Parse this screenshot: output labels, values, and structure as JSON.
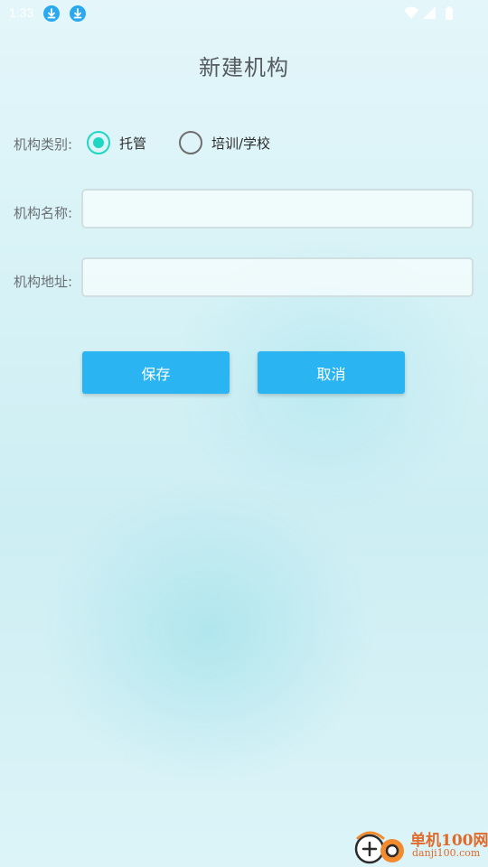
{
  "status_bar": {
    "time": "1:33",
    "icons": [
      "download-icon",
      "download-icon",
      "wifi-icon",
      "signal-icon",
      "battery-icon"
    ]
  },
  "page": {
    "title": "新建机构"
  },
  "form": {
    "category": {
      "label": "机构类别:",
      "options": [
        {
          "label": "托管",
          "checked": true
        },
        {
          "label": "培训/学校",
          "checked": false
        }
      ]
    },
    "name": {
      "label": "机构名称:",
      "value": "",
      "placeholder": ""
    },
    "address": {
      "label": "机构地址:",
      "value": "",
      "placeholder": ""
    }
  },
  "actions": {
    "save_label": "保存",
    "cancel_label": "取消"
  },
  "watermark": {
    "name": "单机100网",
    "url": "danji100.com"
  },
  "colors": {
    "accent_radio": "#1ed7c2",
    "button": "#2bb4f2",
    "download_badge": "#2aa9f0",
    "watermark": "#e06a2a"
  }
}
